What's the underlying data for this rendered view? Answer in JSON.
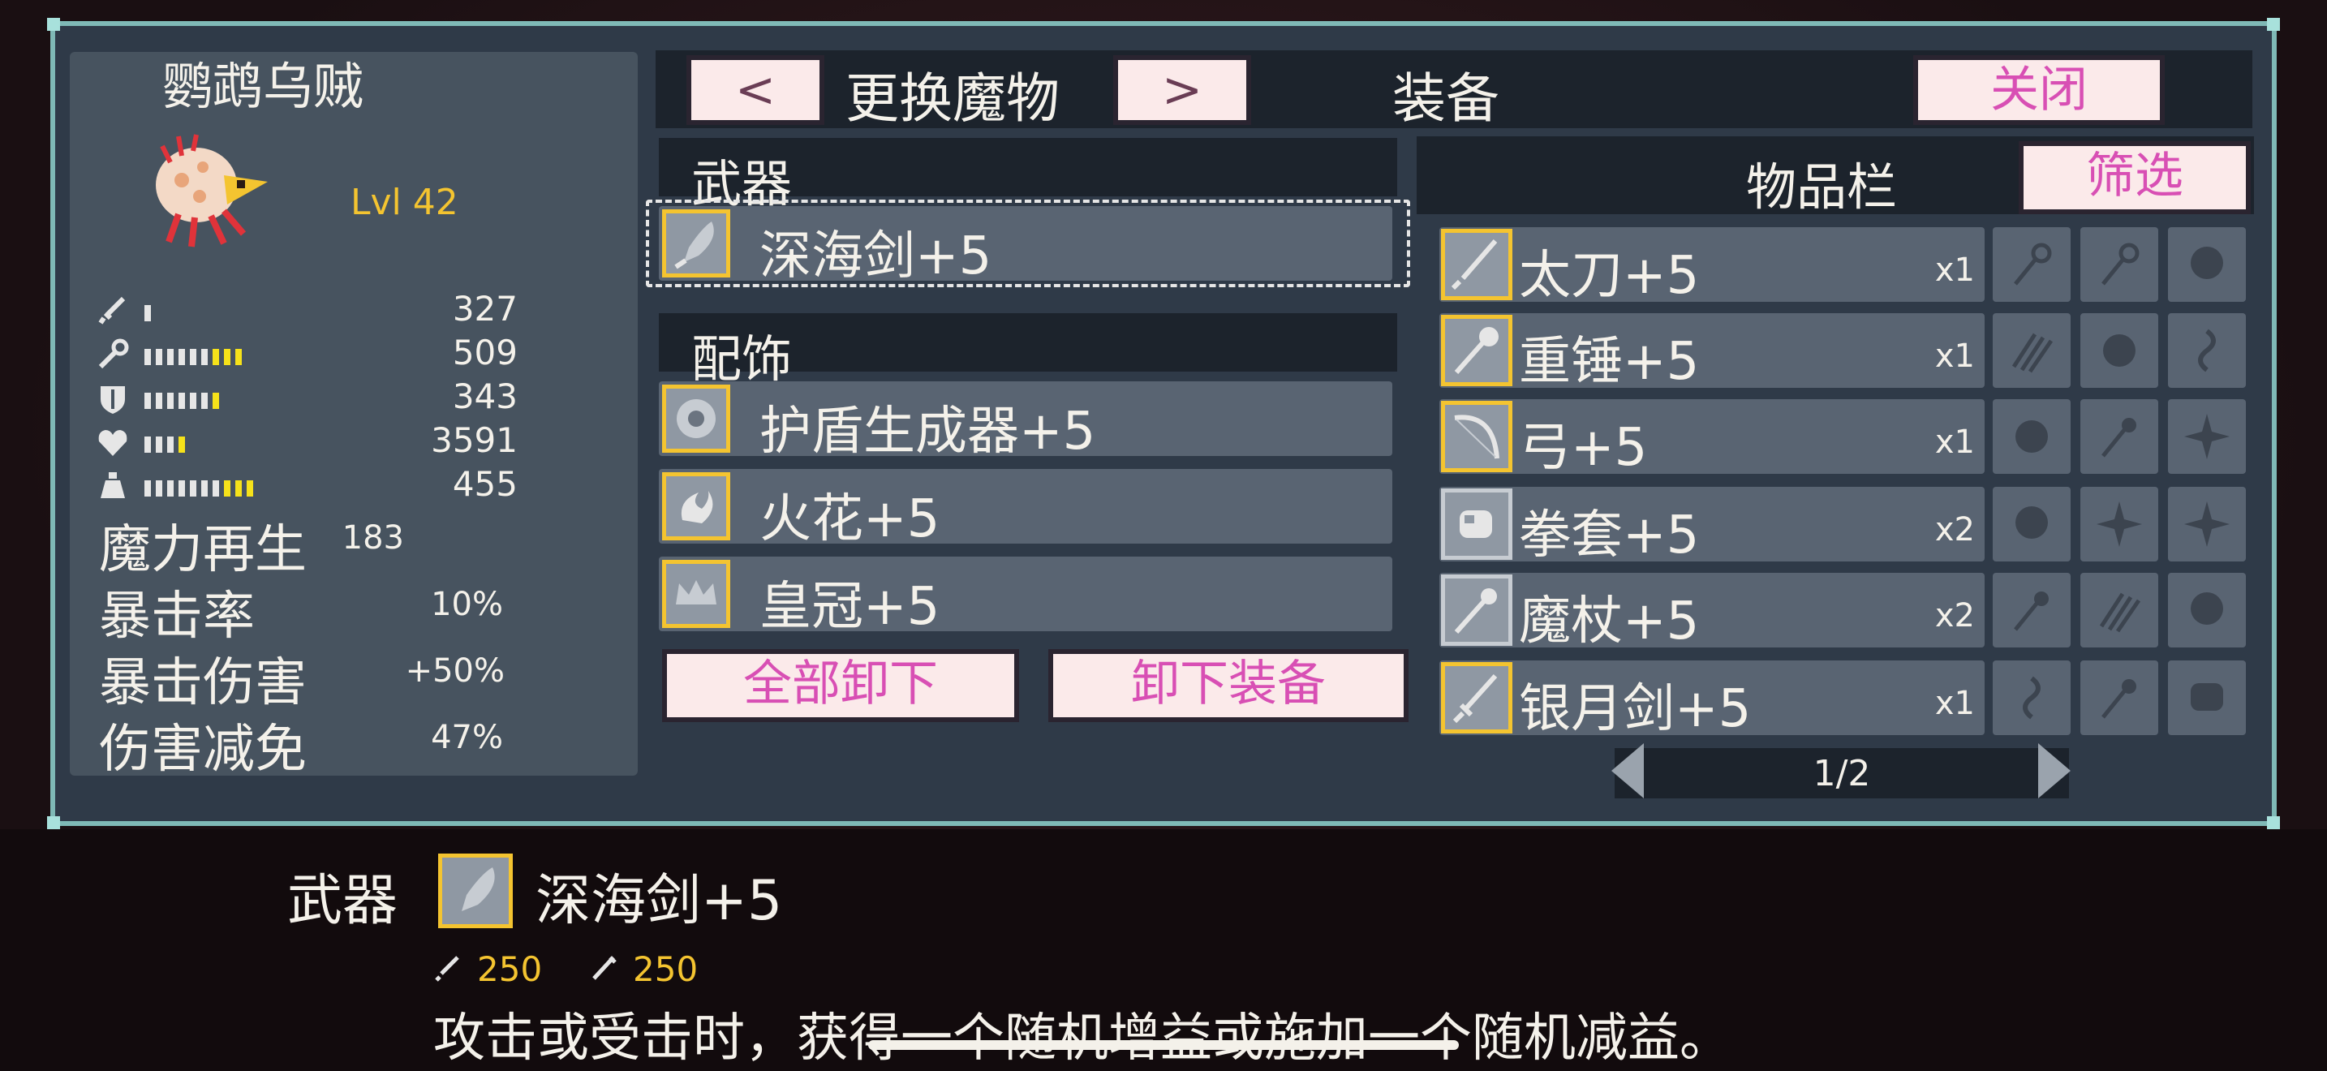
{
  "monster": {
    "name": "鹦鹉乌贼",
    "level": "Lvl 42"
  },
  "stats": [
    {
      "icon": "sword-icon",
      "value": "327",
      "level": 0.08
    },
    {
      "icon": "staff-icon",
      "value": "509",
      "level": 0.75
    },
    {
      "icon": "shield-icon",
      "value": "343",
      "level": 0.5
    },
    {
      "icon": "heart-icon",
      "value": "3591",
      "level": 0.33
    },
    {
      "icon": "potion-icon",
      "value": "455",
      "level": 0.8
    }
  ],
  "text_stats": [
    {
      "label": "魔力再生",
      "value": "183"
    },
    {
      "label": "暴击率",
      "value": "10%"
    },
    {
      "label": "暴击伤害",
      "value": "+50%"
    },
    {
      "label": "伤害减免",
      "value": "47%"
    }
  ],
  "header": {
    "prev_label": "<",
    "change_monster_label": "更换魔物",
    "next_label": ">",
    "equipment_title": "装备",
    "close_label": "关闭"
  },
  "weapon": {
    "section_label": "武器",
    "item": "深海剑+5"
  },
  "accessories": {
    "section_label": "配饰",
    "items": [
      "护盾生成器+5",
      "火花+5",
      "皇冠+5"
    ]
  },
  "actions": {
    "unequip_all_label": "全部卸下",
    "unequip_label": "卸下装备"
  },
  "inventory": {
    "title": "物品栏",
    "filter_label": "筛选",
    "items": [
      {
        "name": "太刀+5",
        "count": "x1"
      },
      {
        "name": "重锤+5",
        "count": "x1"
      },
      {
        "name": "弓+5",
        "count": "x1"
      },
      {
        "name": "拳套+5",
        "count": "x2"
      },
      {
        "name": "魔杖+5",
        "count": "x2"
      },
      {
        "name": "银月剑+5",
        "count": "x1"
      }
    ],
    "page": "1/2"
  },
  "details": {
    "category": "武器",
    "name": "深海剑+5",
    "attack": "250",
    "magic_attack": "250",
    "description": "攻击或受击时，获得一个随机增益或施加一个随机减益。"
  },
  "colors": {
    "accent_yellow": "#f4c430",
    "button_text_pink": "#d84fb4",
    "panel_border": "#7fb9b6",
    "panel_bg": "#2f3a48"
  }
}
